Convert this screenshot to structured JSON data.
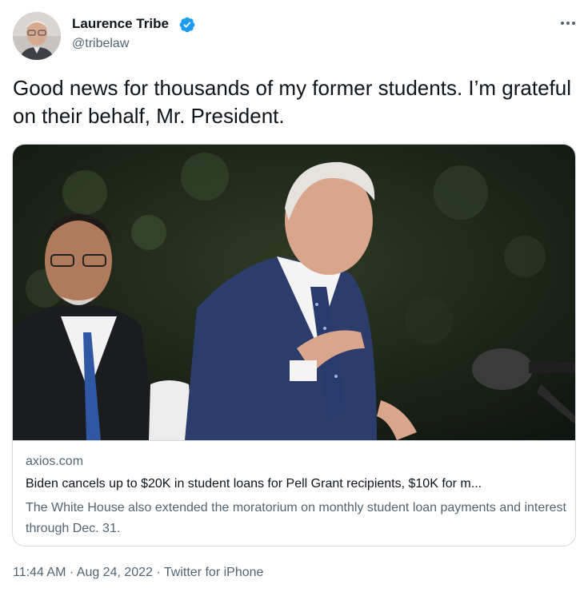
{
  "author": {
    "name": "Laurence Tribe",
    "handle": "@tribelaw",
    "verified": true
  },
  "more_icon": "ellipsis-icon",
  "tweet": {
    "text": "Good news for thousands of my former students. I’m grateful on their behalf, Mr. President."
  },
  "link_card": {
    "domain": "axios.com",
    "title": "Biden cancels up to $20K in student loans for Pell Grant recipients, $10K for m...",
    "description": "The White House also extended the moratorium on monthly student loan payments and interest through Dec. 31."
  },
  "meta": {
    "time": "11:44 AM",
    "separator_1": " · ",
    "date": "Aug 24, 2022",
    "separator_2": " · ",
    "source": "Twitter for iPhone"
  },
  "colors": {
    "verified_blue": "#1d9bf0",
    "text_primary": "#0f1419",
    "text_secondary": "#536471",
    "border": "#cfd9de"
  }
}
